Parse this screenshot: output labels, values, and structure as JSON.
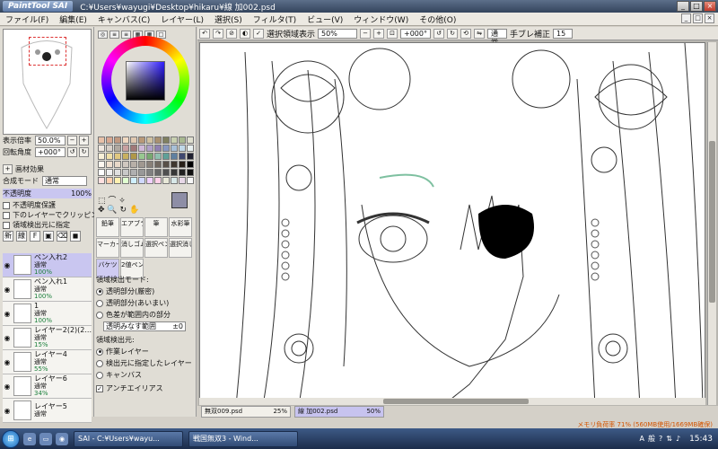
{
  "window": {
    "app_logo": "PaintTool SAI",
    "title": "C:¥Users¥wayugi¥Desktop¥hikaru¥線 加002.psd",
    "controls": [
      "_",
      "□",
      "×"
    ]
  },
  "menu": [
    "ファイル(F)",
    "編集(E)",
    "キャンバス(C)",
    "レイヤー(L)",
    "選択(S)",
    "フィルタ(T)",
    "ビュー(V)",
    "ウィンドウ(W)",
    "その他(O)"
  ],
  "mdi_controls": [
    "_",
    "□",
    "×"
  ],
  "navigator": {
    "zoom_label": "表示倍率",
    "zoom_value": "50.0%",
    "rotate_label": "回転角度",
    "rotate_value": "+000°"
  },
  "paper_texture": "画材効果",
  "blend": {
    "label": "合成モード",
    "value": "通常"
  },
  "opacity": {
    "label": "不透明度",
    "value": "100%"
  },
  "layer_options": [
    {
      "label": "不透明度保護",
      "checked": false
    },
    {
      "label": "下のレイヤーでクリッピング",
      "checked": false
    },
    {
      "label": "領域検出元に指定",
      "checked": false
    }
  ],
  "layer_toolbar": [
    "新",
    "線",
    "F",
    "▣",
    "⌫",
    "◼"
  ],
  "layers": [
    {
      "name": "ペン入れ2",
      "mode": "通常",
      "opacity": "100%",
      "selected": true
    },
    {
      "name": "ペン入れ1",
      "mode": "通常",
      "opacity": "100%",
      "selected": false
    },
    {
      "name": "1",
      "mode": "通常",
      "opacity": "100%",
      "selected": false
    },
    {
      "name": "レイヤー2(2)(2...",
      "mode": "通常",
      "opacity": "15%",
      "selected": false
    },
    {
      "name": "レイヤー4",
      "mode": "通常",
      "opacity": "55%",
      "selected": false
    },
    {
      "name": "レイヤー6",
      "mode": "通常",
      "opacity": "34%",
      "selected": false
    },
    {
      "name": "レイヤー5",
      "mode": "通常",
      "opacity": "",
      "selected": false
    }
  ],
  "color": {
    "current": "#2f1dff",
    "fg_swatch": "#8e8ea6",
    "swatches": [
      "#e8c0a8",
      "#d8a890",
      "#c09880",
      "#f0d8c0",
      "#e0c8b0",
      "#b89878",
      "#d0c0a0",
      "#a89070",
      "#808060",
      "#c8d0b0",
      "#a8b890",
      "#e0e0d0",
      "#f0e8e0",
      "#d8d0c8",
      "#b0a8a0",
      "#c8a0a0",
      "#a07878",
      "#d0b8d8",
      "#b0a0c8",
      "#9080b0",
      "#8898c0",
      "#a8c0d8",
      "#c0d8e8",
      "#e8f0f0",
      "#f8f0d8",
      "#f0e0a8",
      "#e0c880",
      "#c8b060",
      "#b09848",
      "#98c890",
      "#78a870",
      "#90c0b0",
      "#60a098",
      "#6080a0",
      "#404870",
      "#202030",
      "#fff8f0",
      "#f0e0d0",
      "#e8d8c8",
      "#d0c8c0",
      "#b8b0a8",
      "#a09890",
      "#888078",
      "#706860",
      "#585048",
      "#403830",
      "#282018",
      "#000000",
      "#ffffff",
      "#f0f0f0",
      "#e0e0e0",
      "#c8c8c8",
      "#b0b0b0",
      "#989898",
      "#808080",
      "#686868",
      "#505050",
      "#383838",
      "#202020",
      "#101010",
      "#ffe0e0",
      "#ffd0b0",
      "#fff0b0",
      "#e0ffd0",
      "#d0f0ff",
      "#d0d8ff",
      "#f0d0ff",
      "#ffd0e8",
      "#e8e8d8",
      "#d8e8e8",
      "#e8d8e8",
      "#f8f8f8"
    ]
  },
  "tools": [
    [
      "鉛筆",
      "エアブラシ",
      "筆",
      "水彩筆"
    ],
    [
      "マーカー",
      "消しゴム",
      "選択ペン",
      "選択消し"
    ],
    [
      "バケツ",
      "2値ペン",
      "",
      ""
    ]
  ],
  "selection_mode": {
    "title": "領域検出モード:",
    "options": [
      "透明部分(厳密)",
      "透明部分(あいまい)",
      "色差が範囲内の部分"
    ],
    "selected": 0,
    "tolerance_label": "透明みなす範囲",
    "tolerance_value": "±0"
  },
  "detect_source": {
    "title": "領域検出元:",
    "options": [
      "作業レイヤー",
      "検出元に指定したレイヤー",
      "キャンバス"
    ],
    "selected": 0
  },
  "antialias": {
    "label": "アンチエイリアス",
    "checked": true
  },
  "canvas_toolbar": {
    "show_selection": "選択領域表示",
    "zoom": "50%",
    "rotate": "+000°",
    "mode": "通常",
    "stabilizer_label": "手ブレ補正",
    "stabilizer_value": "15"
  },
  "documents": [
    {
      "name": "無双009.psd",
      "zoom": "25%",
      "selected": false
    },
    {
      "name": "線 加002.psd",
      "zoom": "50%",
      "selected": true
    }
  ],
  "status": "メモリ負荷率 71% (560MB使用/1669MB確保)",
  "taskbar": {
    "tasks": [
      "SAI - C:¥Users¥wayu...",
      "戦国無双3 - Wind..."
    ],
    "clock": "15:43",
    "tray": [
      "A",
      "般",
      "?"
    ]
  }
}
